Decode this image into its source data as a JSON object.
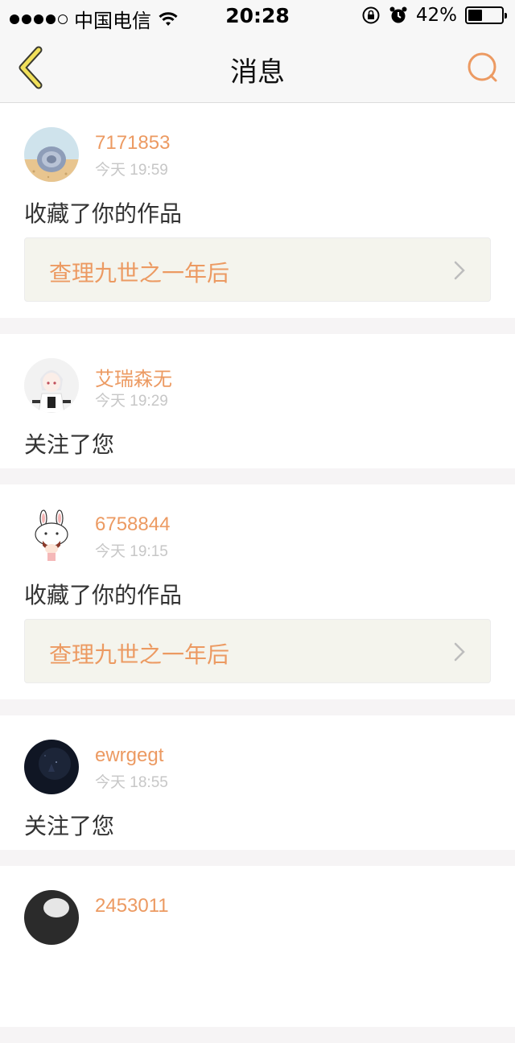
{
  "status_bar": {
    "carrier": "中国电信",
    "time": "20:28",
    "battery_pct": "42%",
    "battery_level": 0.42,
    "signal_bars_filled": 4,
    "signal_bars_total": 5
  },
  "nav": {
    "title": "消息",
    "back_icon": "chevron-left-icon",
    "search_icon": "search-icon"
  },
  "colors": {
    "accent": "#ec9a62",
    "back_icon": "#f1e05a",
    "timestamp": "#c7c7c7",
    "work_bg": "#f4f4ed",
    "page_bg": "#f6f4f5"
  },
  "messages": [
    {
      "username": "7171853",
      "time": "今天 19:59",
      "action": "收藏了你的作品",
      "work_title": "查理九世之一年后",
      "avatar": "snail-shell-avatar"
    },
    {
      "username": "艾瑞森无",
      "time": "今天 19:29",
      "action": "关注了您",
      "avatar": "anime-girl-avatar"
    },
    {
      "username": "6758844",
      "time": "今天 19:15",
      "action": "收藏了你的作品",
      "work_title": "查理九世之一年后",
      "avatar": "bunny-hat-avatar"
    },
    {
      "username": "ewrgegt",
      "time": "今天 18:55",
      "action": "关注了您",
      "avatar": "dark-night-avatar"
    },
    {
      "username": "2453011",
      "avatar": "partial-avatar"
    }
  ]
}
